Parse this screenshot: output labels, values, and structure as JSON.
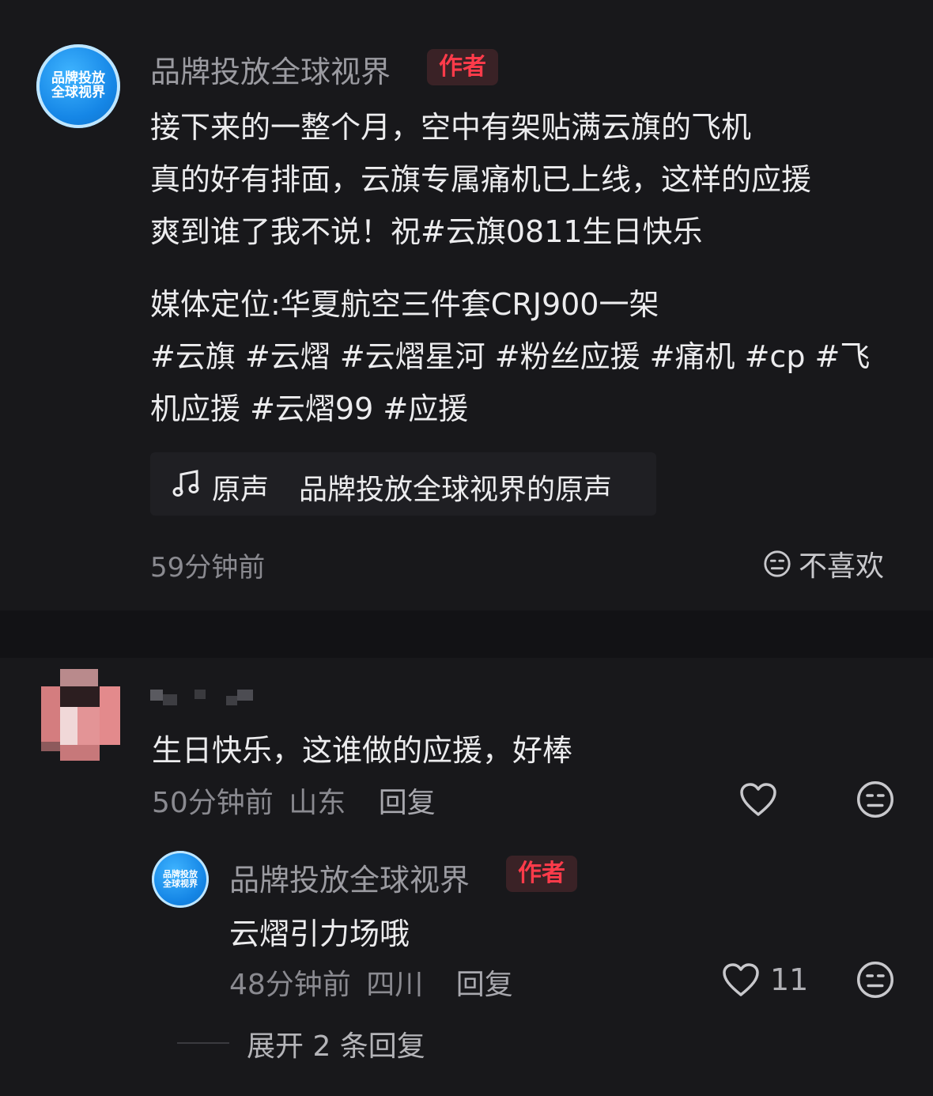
{
  "post": {
    "avatar_text": [
      "品牌投放",
      "全球视界"
    ],
    "username": "品牌投放全球视界",
    "author_badge": "作者",
    "lines": [
      "接下来的一整个月，空中有架贴满云旗的飞机",
      "真的好有排面，云旗专属痛机已上线，这样的应援",
      "爽到谁了我不说！祝#云旗0811生日快乐"
    ],
    "media_line": "媒体定位:华夏航空三件套CRJ900一架",
    "hashtag_lines": [
      "#云旗 #云熠 #云熠星河 #粉丝应援 #痛机 #cp #飞",
      "机应援 #云熠99 #应援"
    ],
    "music": {
      "label": "原声",
      "title": "品牌投放全球视界的原声"
    },
    "time": "59分钟前",
    "dislike_label": "不喜欢"
  },
  "comments": [
    {
      "text": "生日快乐，这谁做的应援，好棒",
      "time": "50分钟前",
      "location": "山东",
      "reply_label": "回复",
      "reply": {
        "avatar_text": [
          "品牌投放",
          "全球视界"
        ],
        "username": "品牌投放全球视界",
        "author_badge": "作者",
        "text": "云熠引力场哦",
        "time": "48分钟前",
        "location": "四川",
        "reply_label": "回复",
        "like_count": "11"
      }
    }
  ],
  "expand_replies": "展开 2 条回复",
  "colors": {
    "accent_red": "#ff3b4a",
    "hashtag": "#ffffff",
    "background": "#18181b"
  },
  "icons": [
    "music-note-icon",
    "dislike-face-icon",
    "heart-icon"
  ]
}
